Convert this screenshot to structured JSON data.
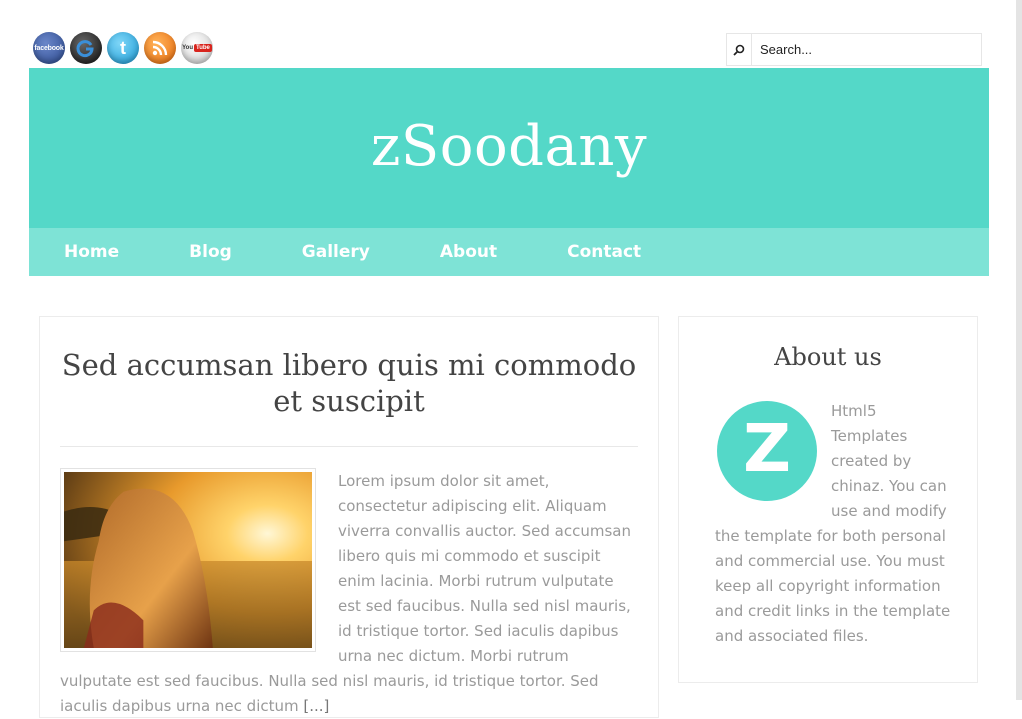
{
  "social": [
    {
      "name": "facebook",
      "label": "facebook"
    },
    {
      "name": "google-plus",
      "label": "G"
    },
    {
      "name": "twitter",
      "label": "t"
    },
    {
      "name": "rss",
      "label": ""
    },
    {
      "name": "youtube",
      "label_you": "You",
      "label_tube": "Tube"
    }
  ],
  "search": {
    "placeholder": "Search..."
  },
  "header": {
    "site_title": "zSoodany",
    "brand_color": "#54d8c8",
    "nav_color": "#7ee3d6"
  },
  "nav": [
    "Home",
    "Blog",
    "Gallery",
    "About",
    "Contact"
  ],
  "post": {
    "title": "Sed accumsan libero quis mi commodo et suscipit",
    "excerpt": "Lorem ipsum dolor sit amet, consectetur adipiscing elit. Aliquam viverra convallis auctor. Sed accumsan libero quis mi commodo et suscipit enim lacinia. Morbi rutrum vulputate est sed faucibus. Nulla sed nisl mauris, id tristique tortor. Sed iaculis dapibus urna nec dictum. Morbi rutrum vulputate est sed faucibus. Nulla sed nisl mauris, id tristique tortor. Sed iaculis dapibus urna nec dictum",
    "read_more": "[...]"
  },
  "sidebar": {
    "title": "About us",
    "logo_letter": "Z",
    "text": "Html5 Templates created by chinaz. You can use and modify the template for both personal and commercial use. You must keep all copyright information and credit links in the template and associated files."
  }
}
